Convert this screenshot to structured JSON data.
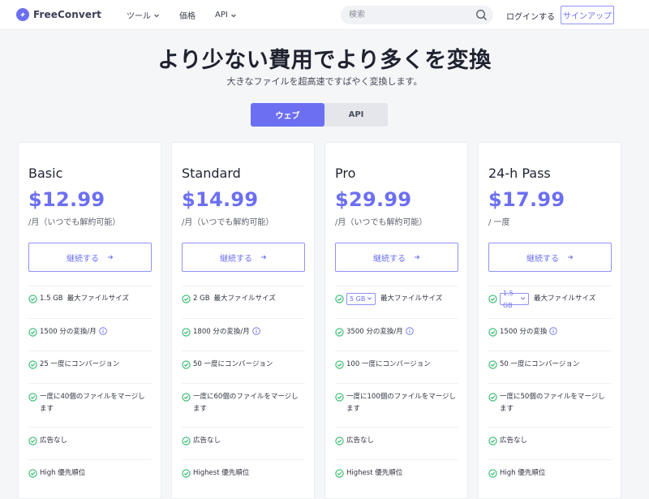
{
  "header": {
    "logo_text": "FreeConvert",
    "nav": [
      "ツール",
      "価格",
      "API"
    ],
    "search_placeholder": "検索",
    "login": "ログインする",
    "signup": "サインアップ"
  },
  "hero": {
    "title": "より少ない費用でより多くを変換",
    "subtitle": "大きなファイルを超高速ですばやく変換します。"
  },
  "toggle": {
    "web": "ウェブ",
    "api": "API"
  },
  "colors": {
    "accent": "#6c6ff2",
    "check": "#2fb86b"
  },
  "plans": [
    {
      "name": "Basic",
      "price": "$12.99",
      "period": "/月（いつでも解約可能）",
      "cta": "継続する",
      "size": "1.5 GB",
      "size_label": "最大ファイルサイズ",
      "conversions_num": "1500",
      "conversions_label": "分の変換/月",
      "concurrent_num": "25",
      "concurrent_label": "一度にコンバージョン",
      "merge": "一度に40個のファイルをマージします",
      "ads": "広告なし",
      "priority": "High 優先順位"
    },
    {
      "name": "Standard",
      "price": "$14.99",
      "period": "/月（いつでも解約可能）",
      "cta": "継続する",
      "size": "2 GB",
      "size_label": "最大ファイルサイズ",
      "conversions_num": "1800",
      "conversions_label": "分の変換/月",
      "concurrent_num": "50",
      "concurrent_label": "一度にコンバージョン",
      "merge": "一度に60個のファイルをマージします",
      "ads": "広告なし",
      "priority": "Highest 優先順位"
    },
    {
      "name": "Pro",
      "price": "$29.99",
      "period": "/月（いつでも解約可能）",
      "cta": "継続する",
      "size": "5 GB",
      "size_label": "最大ファイルサイズ",
      "conversions_num": "3500",
      "conversions_label": "分の変換/月",
      "concurrent_num": "100",
      "concurrent_label": "一度にコンバージョン",
      "merge": "一度に100個のファイルをマージします",
      "ads": "広告なし",
      "priority": "Highest 優先順位"
    },
    {
      "name": "24-h Pass",
      "price": "$17.99",
      "period": "/ 一度",
      "cta": "継続する",
      "size": "1.5 GB",
      "size_label": "最大ファイルサイズ",
      "conversions_num": "1500",
      "conversions_label": "分の変換",
      "concurrent_num": "50",
      "concurrent_label": "一度にコンバージョン",
      "merge": "一度に50個のファイルをマージします",
      "ads": "広告なし",
      "priority": "High 優先順位"
    }
  ]
}
